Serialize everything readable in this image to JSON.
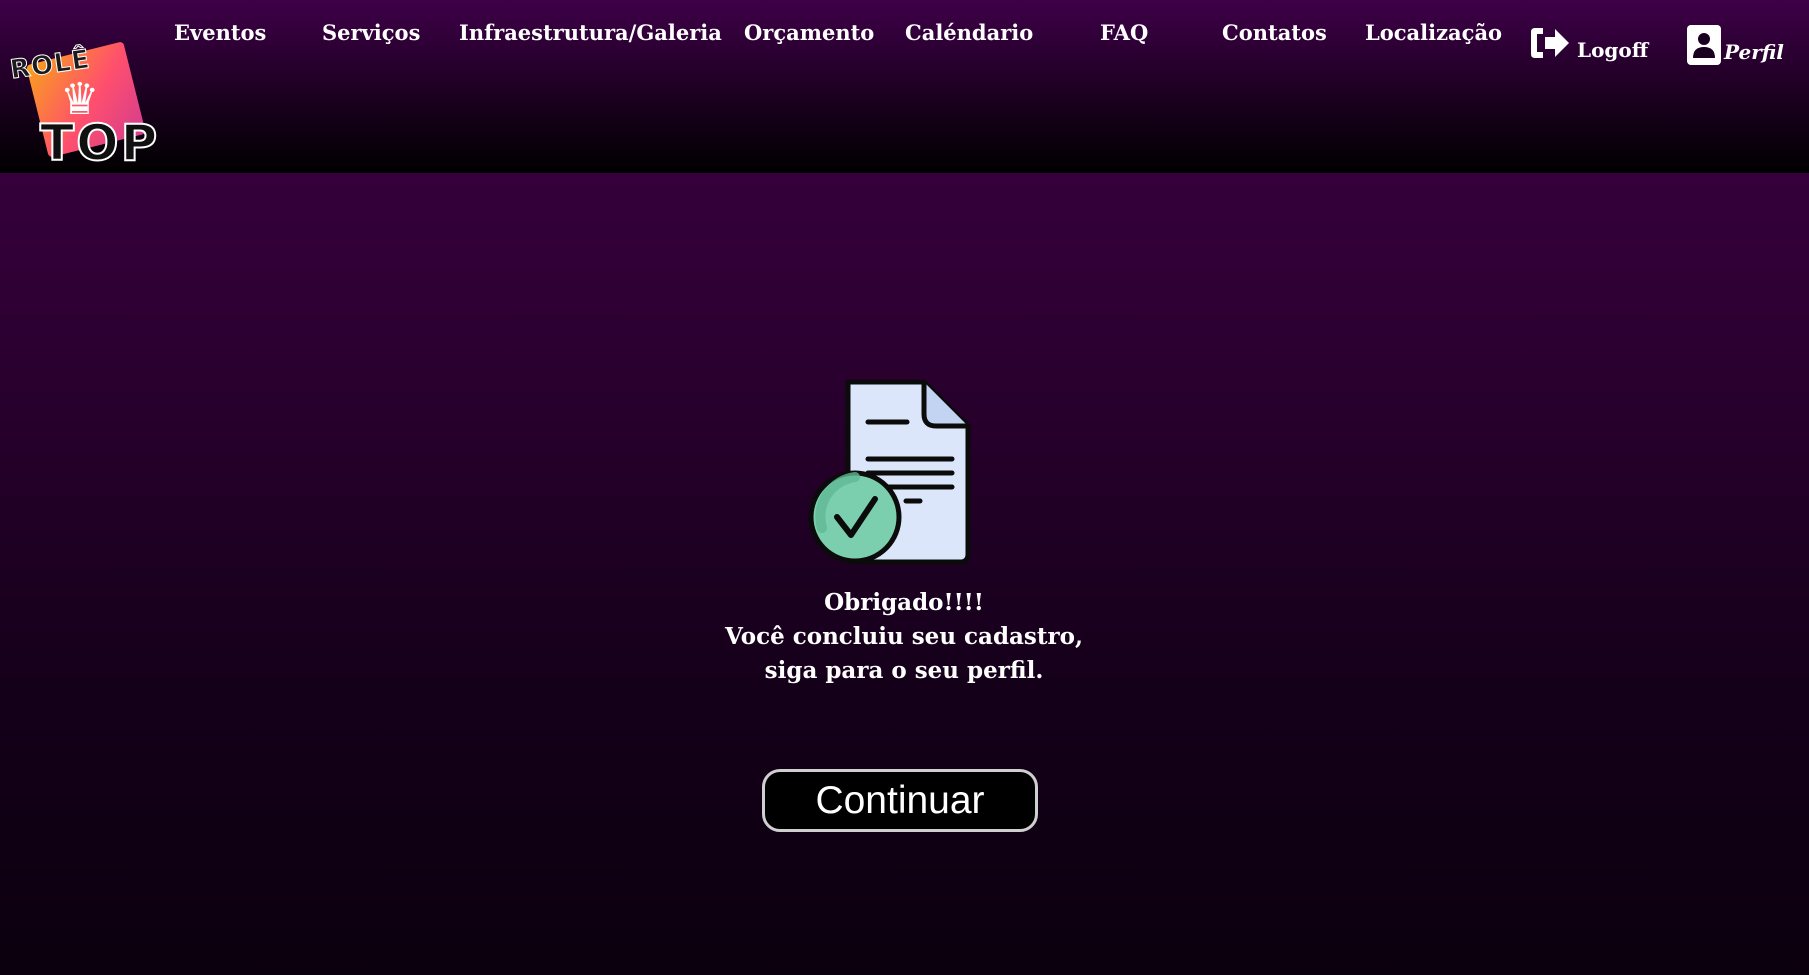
{
  "brand": {
    "logo_top_word": "ROLÊ",
    "logo_bottom_word": "TOP",
    "logo_colors": [
      "#f9a11b",
      "#ff4f6d",
      "#d43d8f"
    ]
  },
  "nav": {
    "items": [
      {
        "label": "Eventos"
      },
      {
        "label": "Serviços"
      },
      {
        "label": "Infraestrutura/Galeria"
      },
      {
        "label": "Orçamento"
      },
      {
        "label": "Caléndario"
      },
      {
        "label": "FAQ"
      },
      {
        "label": "Contatos"
      },
      {
        "label": "Localização"
      }
    ],
    "logoff": {
      "label": "Logoff",
      "icon": "sign-out-icon"
    },
    "perfil": {
      "label": "Perfil",
      "icon": "user-card-icon"
    }
  },
  "main": {
    "illustration_icon": "document-check-icon",
    "message_lines": [
      "Obrigado!!!!",
      "Você concluiu seu cadastro,",
      "siga para o seu perfil."
    ],
    "continue_label": "Continuar"
  },
  "colors": {
    "background_top": "#3f0046",
    "background_bottom": "#0b000e",
    "button_bg": "#000000",
    "button_border": "#cfcfcf",
    "check_green": "#7ccfae",
    "doc_fill": "#dbe6fb"
  }
}
